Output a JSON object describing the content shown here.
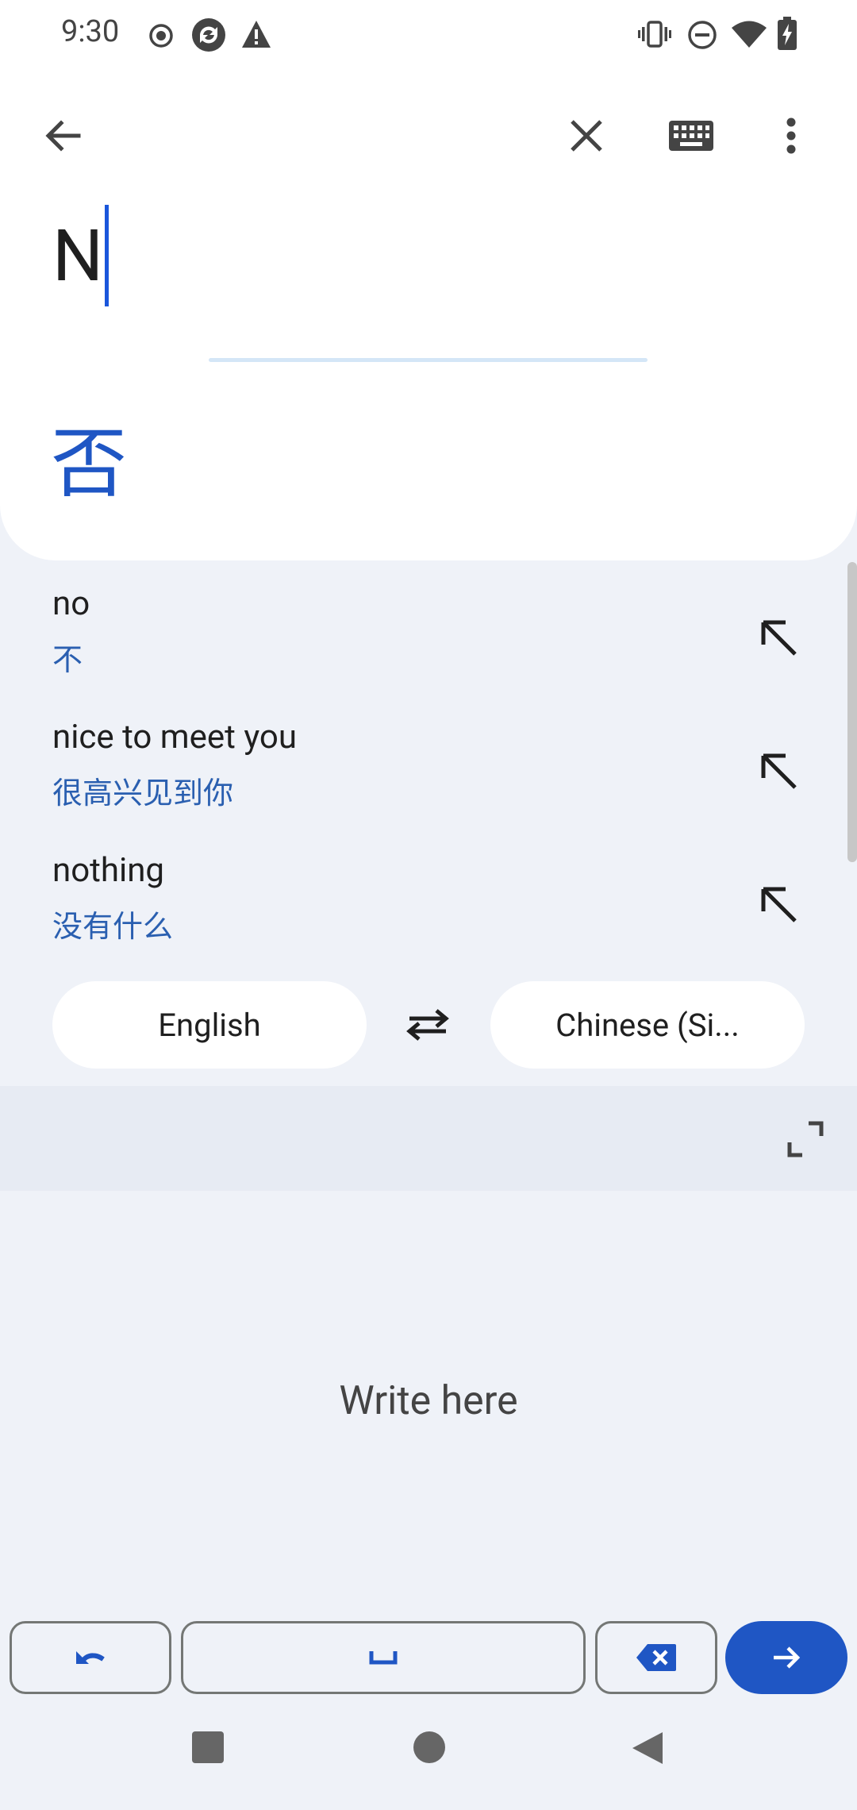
{
  "status_bar": {
    "time": "9:30",
    "icons": [
      "record-icon",
      "sync-icon",
      "warning-icon",
      "vibrate-icon",
      "do-not-disturb-icon",
      "wifi-icon",
      "battery-charging-icon"
    ]
  },
  "toolbar": {
    "back_icon": "arrow-left-icon",
    "clear_icon": "close-icon",
    "keyboard_icon": "keyboard-icon",
    "more_icon": "more-vert-icon"
  },
  "input": {
    "source_text": "N"
  },
  "translation": {
    "text": "否"
  },
  "suggestions": [
    {
      "en": "no",
      "zh": "不"
    },
    {
      "en": "nice to meet you",
      "zh": "很高兴见到你"
    },
    {
      "en": "nothing",
      "zh": "没有什么"
    }
  ],
  "languages": {
    "source": "English",
    "target": "Chinese (Si...",
    "swap_icon": "swap-icon"
  },
  "handwriting": {
    "placeholder": "Write here",
    "expand_icon": "expand-icon"
  },
  "keys": {
    "undo_icon": "undo-icon",
    "space_icon": "space-icon",
    "backspace_icon": "backspace-icon",
    "go_icon": "arrow-right-icon"
  },
  "nav": {
    "recents_icon": "square-icon",
    "home_icon": "circle-icon",
    "back_icon": "triangle-back-icon"
  },
  "colors": {
    "accent": "#1f56c4",
    "background": "#eff2f8",
    "card": "#ffffff",
    "suggestion_translation": "#2a5fb0"
  }
}
